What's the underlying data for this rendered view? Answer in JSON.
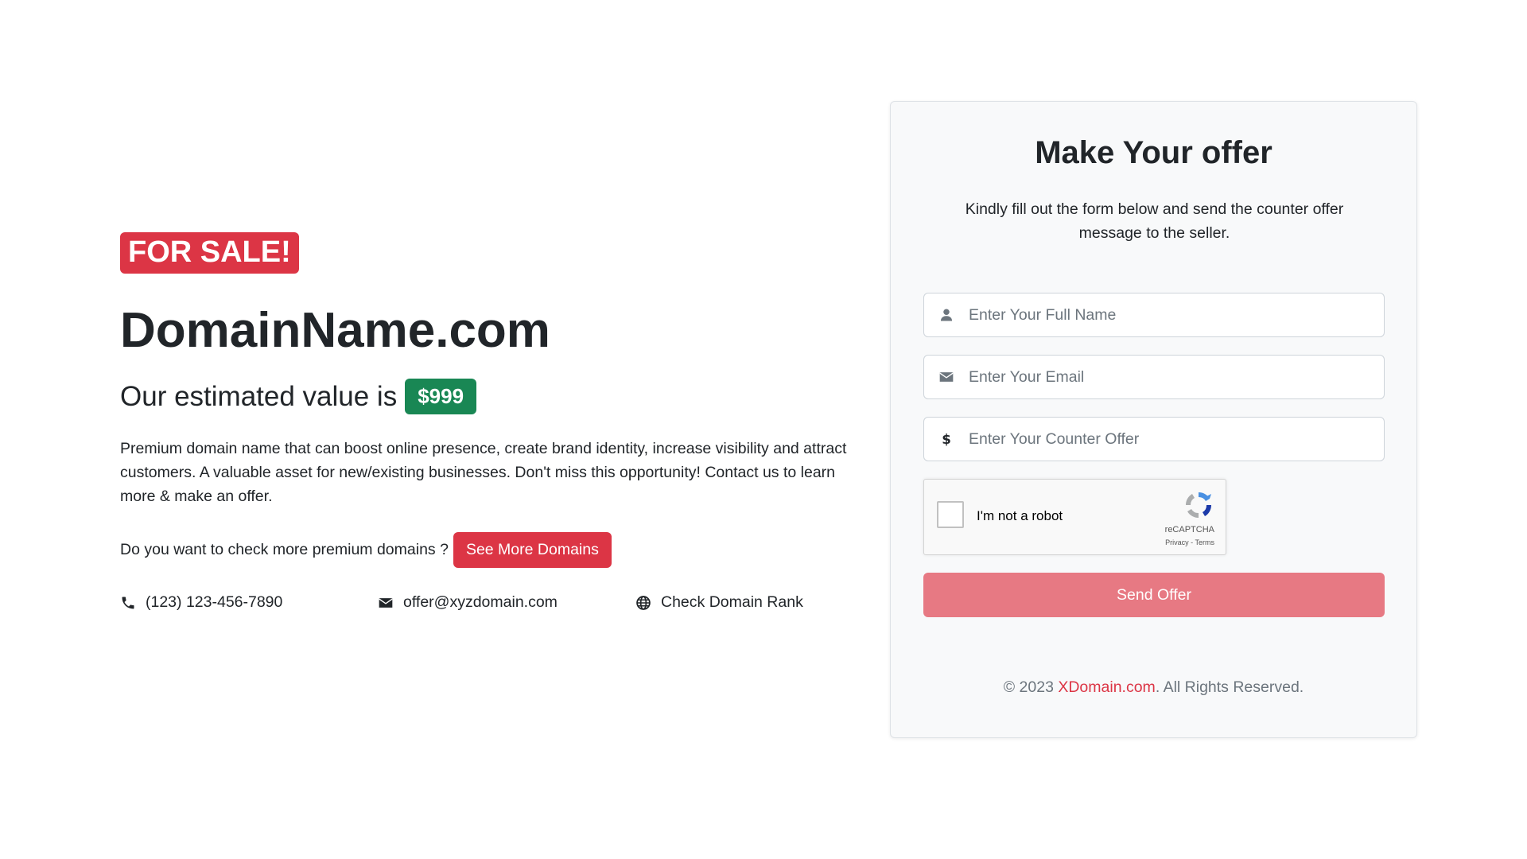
{
  "hero": {
    "sale_badge": "FOR SALE!",
    "domain": "DomainName.com",
    "value_prefix": "Our estimated value is",
    "price": "$999",
    "description": "Premium domain name that can boost online presence, create brand identity, increase visibility and attract customers. A valuable asset for new/existing businesses. Don't miss this opportunity! Contact us to learn more & make an offer.",
    "more_prompt": "Do you want to check more premium domains ?",
    "more_button": "See More Domains"
  },
  "contacts": {
    "phone": "(123) 123-456-7890",
    "email": "offer@xyzdomain.com",
    "rank": "Check Domain Rank"
  },
  "offer_form": {
    "title": "Make Your offer",
    "subtitle": "Kindly fill out the form below and send the counter offer message to the seller.",
    "name_placeholder": "Enter Your Full Name",
    "email_placeholder": "Enter Your Email",
    "offer_placeholder": "Enter Your Counter Offer",
    "captcha_label": "I'm not a robot",
    "captcha_brand": "reCAPTCHA",
    "captcha_terms": "Privacy - Terms",
    "submit": "Send Offer"
  },
  "footer": {
    "prefix": "© 2023",
    "link": "XDomain.com",
    "suffix": ". All Rights Reserved."
  },
  "colors": {
    "danger": "#dc3545",
    "success": "#198754",
    "submit_disabled": "#e77983",
    "card_bg": "#f8f9fa"
  },
  "icons": [
    "phone-icon",
    "envelope-icon",
    "globe-icon",
    "user-icon",
    "dollar-icon",
    "recaptcha-logo"
  ]
}
